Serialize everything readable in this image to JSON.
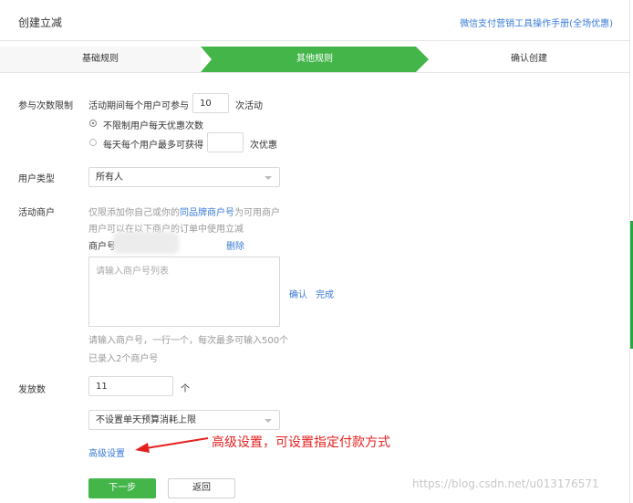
{
  "header": {
    "title": "创建立减",
    "help_link": "微信支付营销工具操作手册(全场优惠)"
  },
  "steps": [
    {
      "label": "基础规则",
      "state": "done"
    },
    {
      "label": "其他规则",
      "state": "active"
    },
    {
      "label": "确认创建",
      "state": "todo"
    }
  ],
  "participation": {
    "label": "参与次数限制",
    "prefix": "活动期间每个用户可参与",
    "times_value": "10",
    "suffix": "次活动",
    "options": [
      {
        "label": "不限制用户每天优惠次数",
        "checked": true
      },
      {
        "label": "每天每个用户最多可获得",
        "checked": false
      }
    ],
    "daily_value": "",
    "daily_suffix": "次优惠"
  },
  "user_type": {
    "label": "用户类型",
    "selected": "所有人"
  },
  "merchant": {
    "label": "活动商户",
    "hint_prefix": "仅限添加你自己或你的",
    "hint_link": "同品牌商户号",
    "hint_suffix": "为可用商户",
    "hint_line2": "用户可以在以下商户的订单中使用立减",
    "id_label": "商户号",
    "delete_label": "删除",
    "textarea_placeholder": "请输入商户号列表",
    "confirm_label": "确认",
    "done_label": "完成",
    "input_tip": "请输入商户号，一行一个，每次最多可输入500个",
    "entered_count": "已录入2个商户号"
  },
  "issue": {
    "label": "发放数",
    "value": "11",
    "unit": "个",
    "budget_selected": "不设置单天预算消耗上限"
  },
  "advanced_link": "高级设置",
  "annotation": "高级设置，可设置指定付款方式",
  "buttons": {
    "next": "下一步",
    "back": "返回"
  },
  "watermark": "https://blog.csdn.net/u013176571",
  "colors": {
    "primary_green": "#44b549",
    "link_blue": "#3a7bd5",
    "annotation_red": "#e62020"
  }
}
